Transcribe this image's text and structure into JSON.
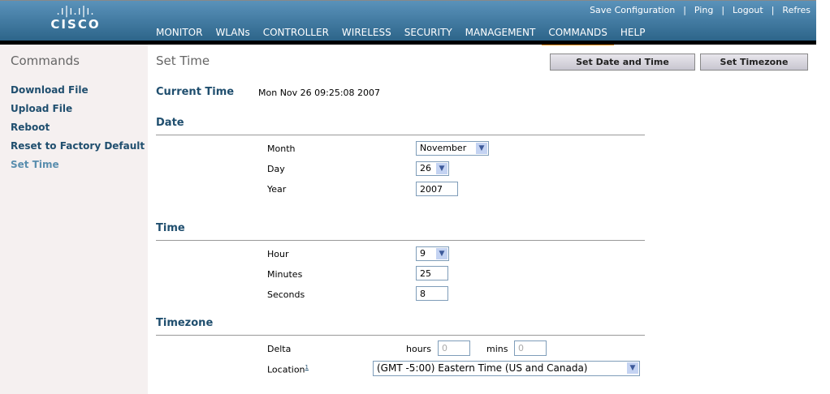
{
  "header": {
    "logo_bars": ".ı|ı.ı|ı.",
    "logo_text": "CISCO",
    "links": [
      "Save Configuration",
      "|",
      "Ping",
      "|",
      "Logout",
      "|",
      "Refres"
    ],
    "nav": [
      "MONITOR",
      "WLANs",
      "CONTROLLER",
      "WIRELESS",
      "SECURITY",
      "MANAGEMENT",
      "COMMANDS",
      "HELP"
    ],
    "active_nav": "COMMANDS"
  },
  "sidebar": {
    "title": "Commands",
    "items": [
      "Download File",
      "Upload File",
      "Reboot",
      "Reset to Factory Default",
      "Set Time"
    ]
  },
  "main": {
    "title": "Set Time",
    "btn_set_date": "Set Date and Time",
    "btn_set_tz": "Set Timezone",
    "current_time_label": "Current Time",
    "current_time": "Mon Nov 26 09:25:08 2007",
    "date": {
      "heading": "Date",
      "month_label": "Month",
      "month": "November",
      "day_label": "Day",
      "day": "26",
      "year_label": "Year",
      "year": "2007"
    },
    "time": {
      "heading": "Time",
      "hour_label": "Hour",
      "hour": "9",
      "minutes_label": "Minutes",
      "minutes": "25",
      "seconds_label": "Seconds",
      "seconds": "8"
    },
    "timezone": {
      "heading": "Timezone",
      "delta_label": "Delta",
      "hours_label": "hours",
      "hours": "0",
      "mins_label": "mins",
      "mins": "0",
      "location_label": "Location",
      "footnote": "1",
      "location": "(GMT -5:00) Eastern Time (US and Canada)"
    }
  },
  "figure_id": "203149"
}
